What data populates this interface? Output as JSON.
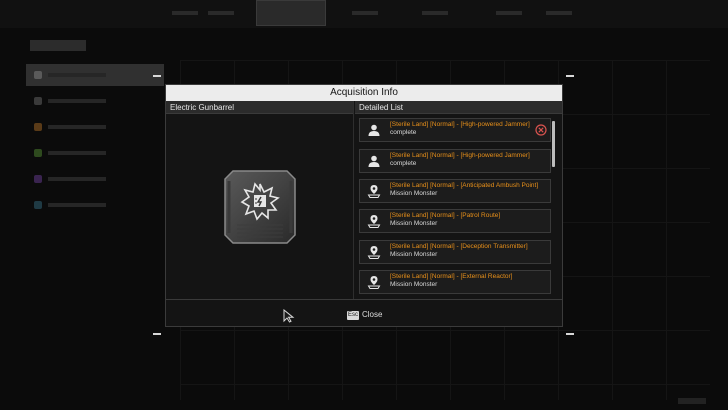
{
  "modal": {
    "title": "Acquisition Info",
    "left_header": "Electric Gunbarrel",
    "right_header": "Detailed List",
    "close_key": "Esc",
    "close_label": "Close"
  },
  "entries": [
    {
      "location": "[Sterile Land] [Normal] - [High-powered Jammer]",
      "status": "complete",
      "icon": "person-icon",
      "badge": "cancel-badge-icon"
    },
    {
      "location": "[Sterile Land] [Normal] - [High-powered Jammer]",
      "status": "complete",
      "icon": "person-icon"
    },
    {
      "location": "[Sterile Land] [Normal] - [Anticipated Ambush Point]",
      "status": "Mission Monster",
      "icon": "map-pin-icon"
    },
    {
      "location": "[Sterile Land] [Normal] - [Patrol Route]",
      "status": "Mission Monster",
      "icon": "map-pin-icon"
    },
    {
      "location": "[Sterile Land] [Normal] - [Deception Transmitter]",
      "status": "Mission Monster",
      "icon": "map-pin-icon"
    },
    {
      "location": "[Sterile Land] [Normal] - [External Reactor]",
      "status": "Mission Monster",
      "icon": "map-pin-icon"
    }
  ],
  "colors": {
    "accent_orange": "#e8901a",
    "header_bg": "#ececec",
    "badge_red": "#d9534f"
  },
  "icons": {
    "module": "electric-gunbarrel-module-icon",
    "cursor": "mouse-cursor-icon"
  }
}
